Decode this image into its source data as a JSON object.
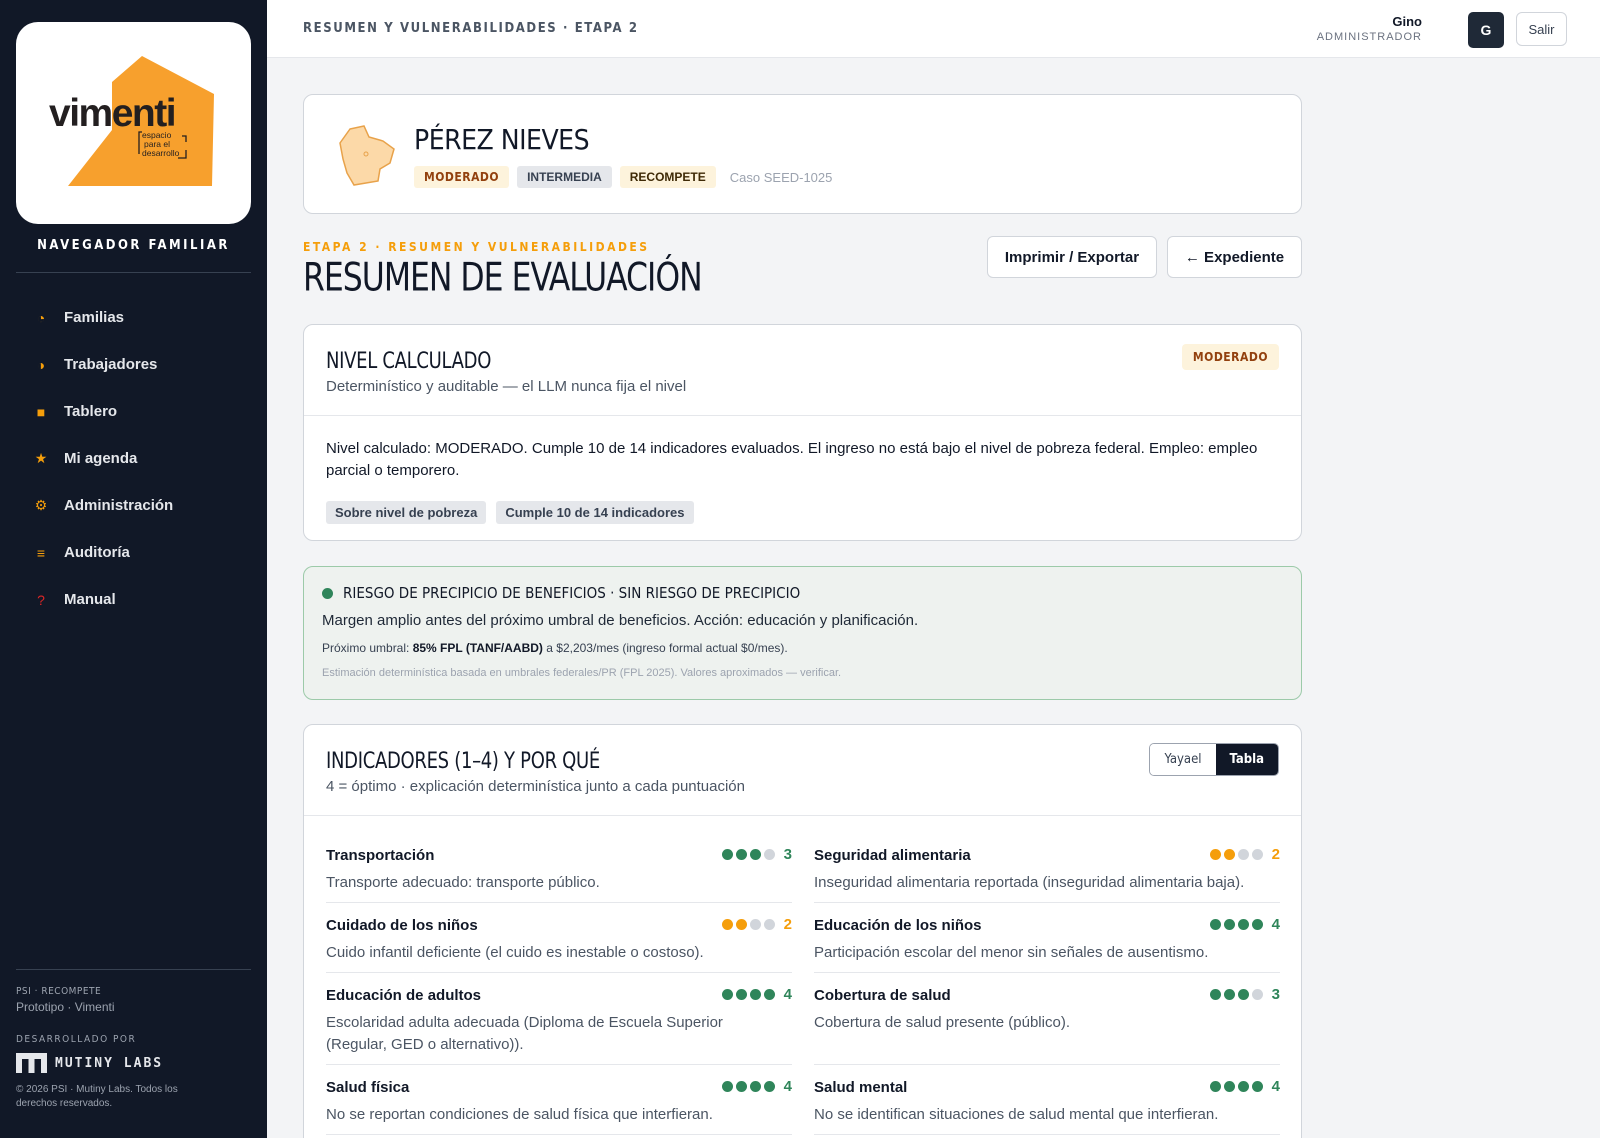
{
  "colors": {
    "accent": "#f59e0b",
    "sidebar_bg": "#111827",
    "score_green": "#2f855a",
    "score_orange": "#f59e0b",
    "score_empty": "#d1d5db"
  },
  "sidebar": {
    "title": "NAVEGADOR FAMILIAR",
    "logo": {
      "brand": "vimenti",
      "tagline": [
        "espacio",
        "para el",
        "desarrollo"
      ]
    },
    "items": [
      {
        "label": "Familias",
        "icon": "pie-icon",
        "glyph": "◔",
        "color": "#f59e0b"
      },
      {
        "label": "Trabajadores",
        "icon": "half-circle-icon",
        "glyph": "◑",
        "color": "#f59e0b"
      },
      {
        "label": "Tablero",
        "icon": "square-icon",
        "glyph": "■",
        "color": "#f59e0b"
      },
      {
        "label": "Mi agenda",
        "icon": "star-icon",
        "glyph": "★",
        "color": "#f59e0b"
      },
      {
        "label": "Administración",
        "icon": "gear-icon",
        "glyph": "⚙",
        "color": "#f59e0b"
      },
      {
        "label": "Auditoría",
        "icon": "list-icon",
        "glyph": "≡",
        "color": "#f59e0b"
      },
      {
        "label": "Manual",
        "icon": "question-icon",
        "glyph": "?",
        "color": "#dc2626"
      }
    ],
    "footer": {
      "project": "PSI · RECOMPETE",
      "subtitle": "Prototipo · Vimenti",
      "developed_by": "DESARROLLADO POR",
      "developer": "MUTINY LABS",
      "copyright": "© 2026 PSI · Mutiny Labs. Todos los derechos reservados."
    }
  },
  "topbar": {
    "breadcrumb": "RESUMEN Y VULNERABILIDADES · ETAPA 2",
    "user_name": "Gino",
    "user_role": "ADMINISTRADOR",
    "avatar_initial": "G",
    "logout_label": "Salir"
  },
  "family": {
    "name": "PÉREZ NIEVES",
    "tags": {
      "level": "MODERADO",
      "type": "INTERMEDIA",
      "program": "RECOMPETE"
    },
    "case_id": "Caso SEED-1025"
  },
  "page": {
    "eyebrow": "ETAPA 2 · RESUMEN Y VULNERABILIDADES",
    "title": "RESUMEN DE EVALUACIÓN",
    "print_label": "Imprimir / Exportar",
    "back_label": "← Expediente"
  },
  "nivel": {
    "title": "NIVEL CALCULADO",
    "subtitle": "Determinístico y auditable — el LLM nunca fija el nivel",
    "badge": "MODERADO",
    "text": "Nivel calculado: MODERADO. Cumple 10 de 14 indicadores evaluados. El ingreso no está bajo el nivel de pobreza federal. Empleo: empleo parcial o temporero.",
    "chips": [
      "Sobre nivel de pobreza",
      "Cumple 10 de 14 indicadores"
    ]
  },
  "risk": {
    "title": "RIESGO DE PRECIPICIO DE BENEFICIOS · SIN RIESGO DE PRECIPICIO",
    "subtitle": "Margen amplio antes del próximo umbral de beneficios. Acción: educación y planificación.",
    "threshold_prefix": "Próximo umbral: ",
    "threshold_bold": "85% FPL (TANF/AABD)",
    "threshold_suffix": " a $2,203/mes (ingreso formal actual $0/mes).",
    "note": "Estimación determinística basada en umbrales federales/PR (FPL 2025). Valores aproximados — verificar."
  },
  "indicators": {
    "title": "INDICADORES (1–4) Y POR QUÉ",
    "subtitle": "4 = óptimo · explicación determinística junto a cada puntuación",
    "view_toggle": {
      "option_a": "Yayael",
      "option_b": "Tabla",
      "selected": "Tabla"
    },
    "max_score": 4,
    "items": [
      {
        "name": "Transportación",
        "score": 3,
        "desc": "Transporte adecuado: transporte público."
      },
      {
        "name": "Seguridad alimentaria",
        "score": 2,
        "desc": "Inseguridad alimentaria reportada (inseguridad alimentaria baja)."
      },
      {
        "name": "Cuidado de los niños",
        "score": 2,
        "desc": "Cuido infantil deficiente (el cuido es inestable o costoso)."
      },
      {
        "name": "Educación de los niños",
        "score": 4,
        "desc": "Participación escolar del menor sin señales de ausentismo."
      },
      {
        "name": "Educación de adultos",
        "score": 4,
        "desc": "Escolaridad adulta adecuada (Diploma de Escuela Superior (Regular, GED o alternativo))."
      },
      {
        "name": "Cobertura de salud",
        "score": 3,
        "desc": "Cobertura de salud presente (público)."
      },
      {
        "name": "Salud física",
        "score": 4,
        "desc": "No se reportan condiciones de salud física que interfieran."
      },
      {
        "name": "Salud mental",
        "score": 4,
        "desc": "No se identifican situaciones de salud mental que interfieran."
      }
    ]
  }
}
